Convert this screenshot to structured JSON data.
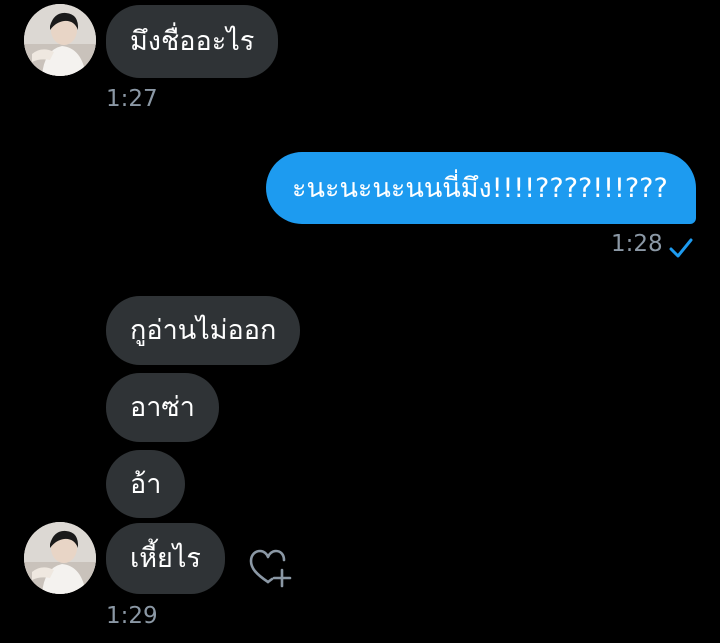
{
  "conversation": {
    "messages": [
      {
        "sender": "them",
        "text": "มึงชื่ออะไร"
      },
      {
        "sender": "me",
        "text": "ะนะนะนะนนนี่มึง!!!!????!!!???"
      },
      {
        "sender": "them",
        "text": "กูอ่านไม่ออก"
      },
      {
        "sender": "them",
        "text": "อาซ่า"
      },
      {
        "sender": "them",
        "text": "อ้า"
      },
      {
        "sender": "them",
        "text": "เหี้ยไร"
      }
    ],
    "timestamps": {
      "first": "1:27",
      "sent": "1:28",
      "last": "1:29"
    }
  },
  "icons": {
    "read_receipt": "checkmark-icon",
    "react": "heart-plus-icon"
  },
  "colors": {
    "background": "#000000",
    "incoming_bubble": "#2f3336",
    "outgoing_bubble": "#1d9bf0",
    "timestamp": "#8b98a5",
    "accent": "#1d9bf0"
  }
}
